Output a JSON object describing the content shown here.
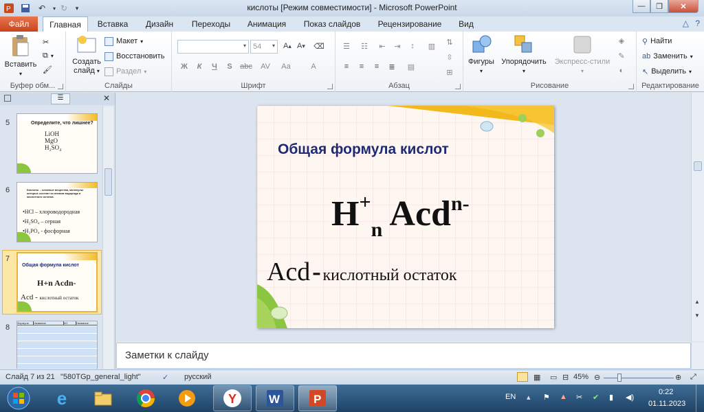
{
  "window": {
    "title": "кислоты [Режим совместимости]  -  Microsoft PowerPoint",
    "buttons": [
      "minimize",
      "restore",
      "close"
    ]
  },
  "tabs": {
    "file": "Файл",
    "items": [
      "Главная",
      "Вставка",
      "Дизайн",
      "Переходы",
      "Анимация",
      "Показ слайдов",
      "Рецензирование",
      "Вид"
    ],
    "active": "Главная"
  },
  "ribbon": {
    "clipboard": {
      "paste": "Вставить",
      "label": "Буфер обм..."
    },
    "slides": {
      "new_slide_1": "Создать",
      "new_slide_2": "слайд",
      "layout": "Макет",
      "reset": "Восстановить",
      "section": "Раздел",
      "label": "Слайды"
    },
    "font": {
      "size": "54",
      "bold": "Ж",
      "italic": "К",
      "underline": "Ч",
      "shadow": "S",
      "strike": "abc",
      "spacing": "AV",
      "case": "Aa",
      "color": "A",
      "label": "Шрифт"
    },
    "paragraph": {
      "label": "Абзац"
    },
    "drawing": {
      "shapes": "Фигуры",
      "arrange": "Упорядочить",
      "quick_styles": "Экспресс-стили",
      "label": "Рисование"
    },
    "editing": {
      "find": "Найти",
      "replace": "Заменить",
      "select": "Выделить",
      "label": "Редактирование"
    }
  },
  "thumbnails": [
    {
      "num": "5",
      "title": "Определите,   что лишнее?",
      "lines": [
        "LiOH",
        "MgO",
        "H₂SO₄"
      ]
    },
    {
      "num": "6",
      "intro": "Кислоты – сложные вещества, молекулы которых состоят из атомов водорода и кислотного остатка.",
      "items": [
        "•HCl – хлороводородная",
        "•H₂SO₄ – серная",
        "•H₃PO₄ - фосфорная"
      ]
    },
    {
      "num": "7",
      "title": "Общая   формула   кислот",
      "formula": "H+n Acdn-",
      "def_main": "Acd -",
      "def_text": "кислотный остаток"
    },
    {
      "num": "8",
      "headers": [
        "Формула",
        "Название",
        "КО",
        "Название"
      ]
    }
  ],
  "slide": {
    "title": "Общая формула кислот",
    "formula": {
      "h": "H",
      "plus": "+",
      "n": "n",
      "acd": "Acd",
      "charge": "n-"
    },
    "definition": {
      "acd": "Acd",
      "dash": "-",
      "text": "кислотный остаток"
    }
  },
  "notes": {
    "placeholder": "Заметки к слайду"
  },
  "status": {
    "slide_info": "Слайд 7 из 21",
    "theme": "\"580TGp_general_light\"",
    "language": "русский",
    "zoom": "45%"
  },
  "taskbar": {
    "apps": [
      "start-orb",
      "internet-explorer",
      "file-explorer",
      "chrome",
      "media-player",
      "yandex-browser",
      "word",
      "powerpoint"
    ],
    "lang": "EN",
    "time": "0:22",
    "date": "01.11.2023"
  },
  "colors": {
    "file_tab": "#d35a2e",
    "accent_yellow": "#f3b81c",
    "accent_green": "#8cc540",
    "slide_title": "#1f2a73"
  }
}
